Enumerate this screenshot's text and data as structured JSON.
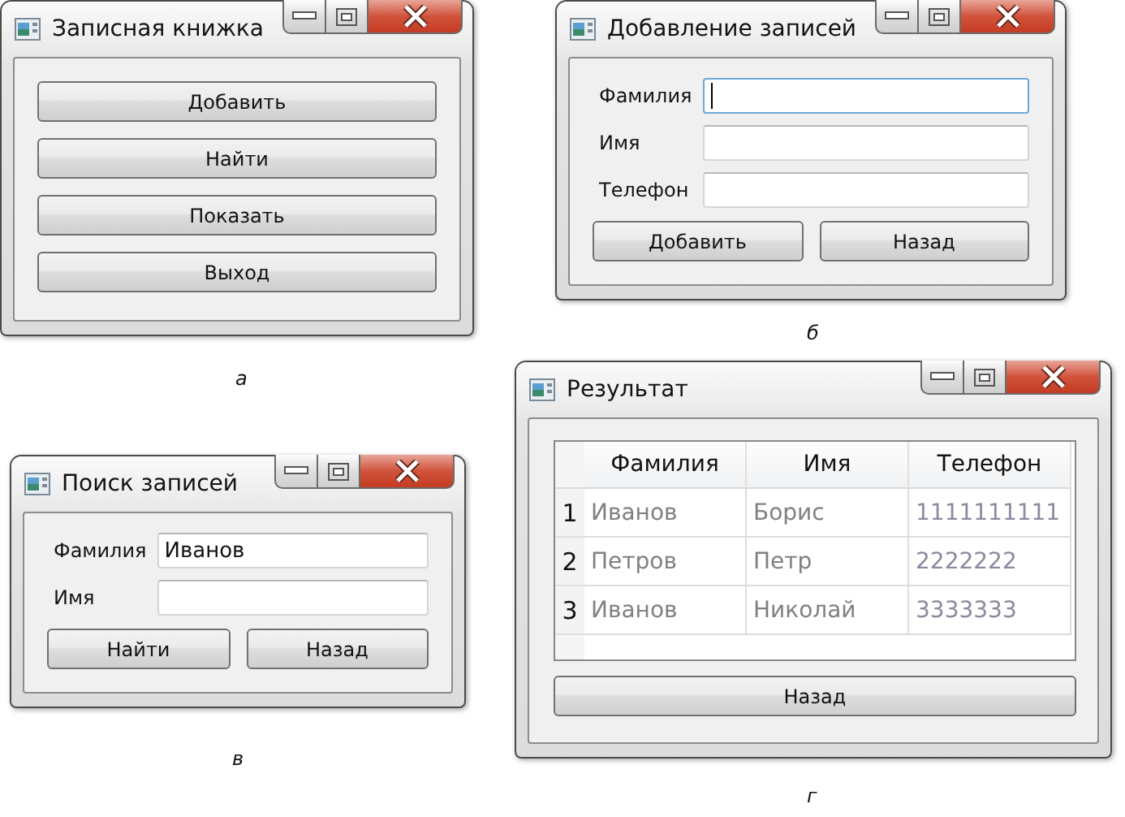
{
  "windows": [
    {
      "kind": "menu",
      "title": "Записная книжка",
      "caption": "а",
      "buttons": [
        "Добавить",
        "Найти",
        "Показать",
        "Выход"
      ]
    },
    {
      "kind": "form",
      "title": "Добавление записей",
      "caption": "б",
      "fields": [
        {
          "label": "Фамилия",
          "focused": true
        },
        {
          "label": "Имя",
          "focused": false
        },
        {
          "label": "Телефон",
          "focused": false
        }
      ],
      "buttons": [
        "Добавить",
        "Назад"
      ]
    },
    {
      "kind": "form",
      "title": "Поиск записей",
      "caption": "в",
      "fields": [
        {
          "label": "Фамилия",
          "value": "Иванов",
          "focused": false
        },
        {
          "label": "Имя",
          "focused": false
        }
      ],
      "buttons": [
        "Найти",
        "Назад"
      ]
    },
    {
      "kind": "table",
      "title": "Результат",
      "caption": "г",
      "columns": [
        "Фамилия",
        "Имя",
        "Телефон"
      ],
      "rows": [
        {
          "header": "1",
          "cells": [
            "Иванов",
            "Борис",
            "1111111111"
          ]
        },
        {
          "header": "2",
          "cells": [
            "Петров",
            "Петр",
            "2222222"
          ]
        },
        {
          "header": "3",
          "cells": [
            "Иванов",
            "Николай",
            "3333333"
          ]
        }
      ],
      "buttons": [
        "Назад"
      ]
    }
  ]
}
